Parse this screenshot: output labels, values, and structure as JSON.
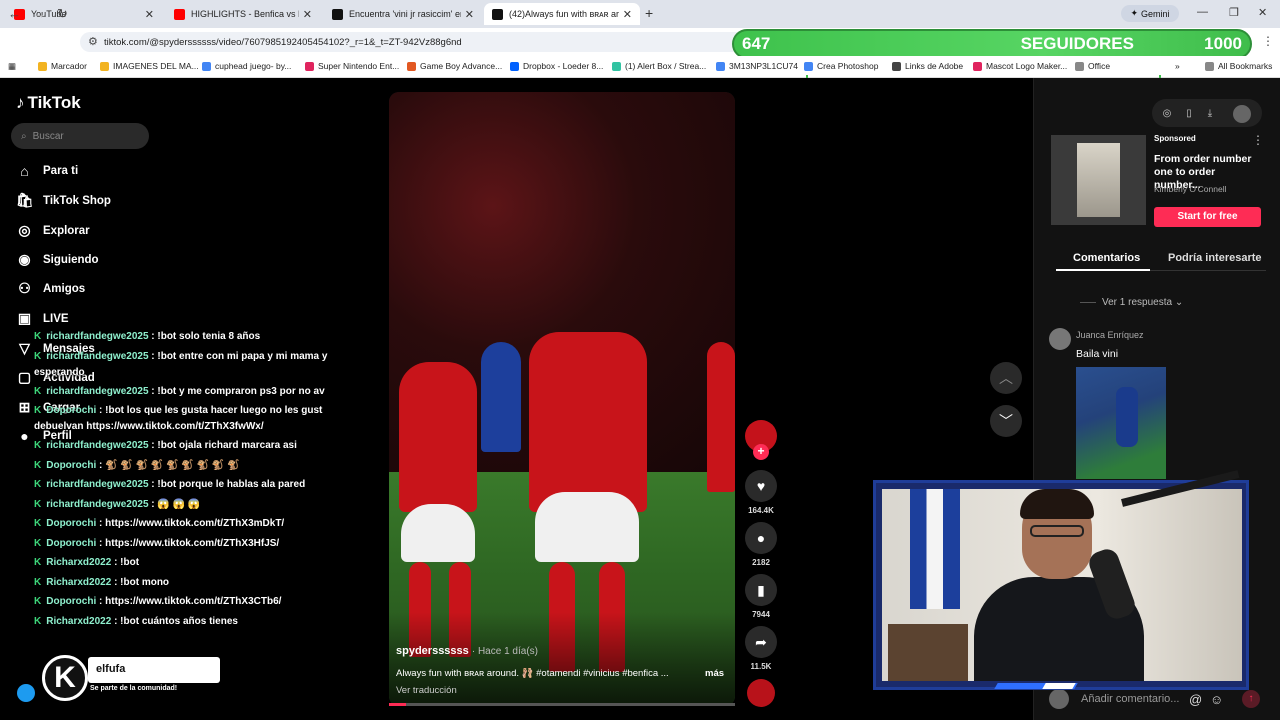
{
  "browser": {
    "tabs": [
      {
        "label": "YouTube",
        "icon": "youtube-icon"
      },
      {
        "label": "HIGHLIGHTS - Benfica vs Real M",
        "icon": "youtube-icon"
      },
      {
        "label": "Encuentra 'vini jr rasiccim' en Ti",
        "icon": "tiktok-icon"
      },
      {
        "label": "(42)Always fun with ʙʀᴀʀ around",
        "icon": "tiktok-icon"
      }
    ],
    "new_tab": "+",
    "gemini_label": "Gemini",
    "url": "tiktok.com/@spyderssssss/video/7607985192405454102?_r=1&_t=ZT-942Vz88g6nd",
    "bookmarks": [
      {
        "label": "Marcador",
        "color": "#f2b321"
      },
      {
        "label": "IMAGENES DEL MA...",
        "color": "#f2b321"
      },
      {
        "label": "cuphead juego- by...",
        "color": "#4285f4"
      },
      {
        "label": "Super Nintendo Ent...",
        "color": "#e0245e"
      },
      {
        "label": "Game Boy Advance...",
        "color": "#e25822"
      },
      {
        "label": "Dropbox - Loeder 8...",
        "color": "#0061fe"
      },
      {
        "label": "(1) Alert Box / Strea...",
        "color": "#31c3a2"
      },
      {
        "label": "3M13NP3L1CU74",
        "color": "#4285f4"
      },
      {
        "label": "Crea Photoshop",
        "color": "#4285f4"
      },
      {
        "label": "Links de Adobe",
        "color": "#444444"
      },
      {
        "label": "Mascot Logo Maker...",
        "color": "#e0245e"
      },
      {
        "label": "Office",
        "color": "#888888"
      }
    ],
    "all_bookmarks": "All Bookmarks"
  },
  "overlay": {
    "followers_current": "647",
    "followers_label": "SEGUIDORES",
    "followers_goal": "1000"
  },
  "sidebar": {
    "logo": "TikTok",
    "search_placeholder": "Buscar",
    "items": [
      {
        "label": "Para ti",
        "icon": "home-icon"
      },
      {
        "label": "TikTok Shop",
        "icon": "shop-icon"
      },
      {
        "label": "Explorar",
        "icon": "compass-icon"
      },
      {
        "label": "Siguiendo",
        "icon": "following-icon"
      },
      {
        "label": "Amigos",
        "icon": "friends-icon"
      },
      {
        "label": "LIVE",
        "icon": "live-icon"
      },
      {
        "label": "Mensajes",
        "icon": "messages-icon"
      },
      {
        "label": "Actividad",
        "icon": "activity-icon"
      },
      {
        "label": "Cargar",
        "icon": "upload-icon"
      },
      {
        "label": "Perfil",
        "icon": "profile-icon"
      }
    ]
  },
  "chat": [
    {
      "user": "richardfandegwe2025",
      "text": ": !bot solo tenia 8 años"
    },
    {
      "user": "richardfandegwe2025",
      "text": ": !bot entre con mi papa y mi mama y"
    },
    {
      "user": "",
      "text": "esperando"
    },
    {
      "user": "richardfandegwe2025",
      "text": ": !bot y me compraron ps3 por no av"
    },
    {
      "user": "Doporochi",
      "text": ": !bot los que les gusta hacer luego no les gust"
    },
    {
      "user": "",
      "text": "debuelvan https://www.tiktok.com/t/ZThX3fwWx/"
    },
    {
      "user": "richardfandegwe2025",
      "text": ": !bot ojala richard marcara asi"
    },
    {
      "user": "Doporochi",
      "text": ": 🐒 🐒 🐒 🐒 🐒 🐒 🐒 🐒 🐒"
    },
    {
      "user": "richardfandegwe2025",
      "text": ": !bot porque le hablas ala pared"
    },
    {
      "user": "richardfandegwe2025",
      "text": ": 😱 😱 😱"
    },
    {
      "user": "Doporochi",
      "text": ": https://www.tiktok.com/t/ZThX3mDkT/"
    },
    {
      "user": "Doporochi",
      "text": ": https://www.tiktok.com/t/ZThX3HfJS/"
    },
    {
      "user": "Richarxd2022",
      "text": ": !bot"
    },
    {
      "user": "Richarxd2022",
      "text": ": !bot mono"
    },
    {
      "user": "Doporochi",
      "text": ": https://www.tiktok.com/t/ZThX3CTb6/"
    },
    {
      "user": "Richarxd2022",
      "text": ": !bot cuántos años tienes"
    }
  ],
  "video": {
    "username": "spyderssssss",
    "posted": "· Hace 1 día(s)",
    "caption": "Always fun with ʙʀᴀʀ around. 🩰 #otamendi #vinicius #benfica ...",
    "more": "más",
    "translate": "Ver traducción",
    "likes": "164.4K",
    "comments": "2182",
    "saves": "7944",
    "shares": "11.5K",
    "progress_fraction": 0.05
  },
  "right_panel": {
    "ad": {
      "sponsored": "Sponsored",
      "title": "From order number one to order number...",
      "author": "Kimberly O'Connell",
      "cta": "Start for free"
    },
    "tabs": [
      "Comentarios",
      "Podría interesarte"
    ],
    "view_replies": "Ver 1 respuesta",
    "comment": {
      "user": "Juanca Enríquez",
      "text": "Baila vini"
    },
    "comment_placeholder": "Añadir comentario..."
  },
  "streamer_badge": {
    "name": "elfufa",
    "sub": "Se parte de la comunidad!"
  },
  "colors": {
    "accent": "#fe2c55",
    "followers_bar": "#4cc85a",
    "chat_user": "#8ff0ce"
  }
}
